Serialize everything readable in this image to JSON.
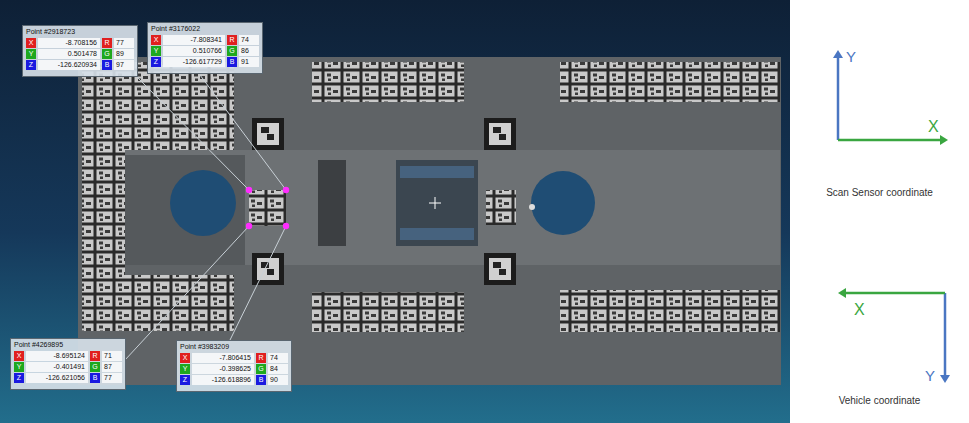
{
  "labels": [
    {
      "title": "Point #2918723",
      "rows": [
        {
          "axis": "X",
          "value": "-8.708156",
          "channel": "R",
          "channel_value": "77",
          "color": "#e01f1f"
        },
        {
          "axis": "Y",
          "value": "0.501478",
          "channel": "G",
          "channel_value": "89",
          "color": "#1ea81e"
        },
        {
          "axis": "Z",
          "value": "-126.620934",
          "channel": "B",
          "channel_value": "97",
          "color": "#1a1ae0"
        }
      ]
    },
    {
      "title": "Point #3176022",
      "rows": [
        {
          "axis": "X",
          "value": "-7.808341",
          "channel": "R",
          "channel_value": "74",
          "color": "#e01f1f"
        },
        {
          "axis": "Y",
          "value": "0.510766",
          "channel": "G",
          "channel_value": "86",
          "color": "#1ea81e"
        },
        {
          "axis": "Z",
          "value": "-126.617729",
          "channel": "B",
          "channel_value": "91",
          "color": "#1a1ae0"
        }
      ]
    },
    {
      "title": "Point #4269895",
      "rows": [
        {
          "axis": "X",
          "value": "-8.695124",
          "channel": "R",
          "channel_value": "71",
          "color": "#e01f1f"
        },
        {
          "axis": "Y",
          "value": "-0.401491",
          "channel": "G",
          "channel_value": "87",
          "color": "#1ea81e"
        },
        {
          "axis": "Z",
          "value": "-126.621056",
          "channel": "B",
          "channel_value": "77",
          "color": "#1a1ae0"
        }
      ]
    },
    {
      "title": "Point #3983209",
      "rows": [
        {
          "axis": "X",
          "value": "-7.806415",
          "channel": "R",
          "channel_value": "74",
          "color": "#e01f1f"
        },
        {
          "axis": "Y",
          "value": "-0.398625",
          "channel": "G",
          "channel_value": "84",
          "color": "#1ea81e"
        },
        {
          "axis": "Z",
          "value": "-126.618896",
          "channel": "B",
          "channel_value": "90",
          "color": "#1a1ae0"
        }
      ]
    }
  ],
  "diagrams": [
    {
      "caption": "Scan Sensor coordinate",
      "x_label": "X",
      "y_label": "Y",
      "x_direction": "right",
      "y_direction": "up"
    },
    {
      "caption": "Vehicle coordinate",
      "x_label": "X",
      "y_label": "Y",
      "x_direction": "left",
      "y_direction": "down"
    }
  ]
}
